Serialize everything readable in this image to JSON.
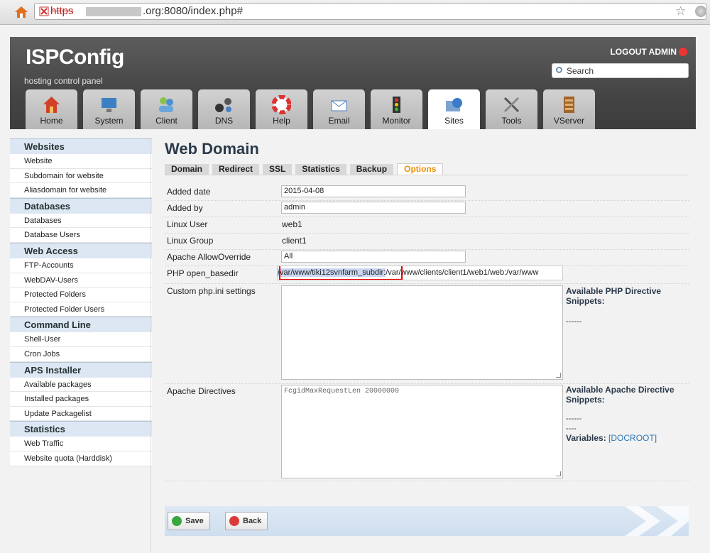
{
  "browser": {
    "url_protocol": "https",
    "url_rest": ".org:8080/index.php#"
  },
  "header": {
    "logo": "ISPConfig",
    "tagline": "hosting control panel",
    "logout": "LOGOUT ADMIN",
    "search_label": "Search"
  },
  "tabs": [
    {
      "label": "Home",
      "icon": "house-icon"
    },
    {
      "label": "System",
      "icon": "monitor-icon"
    },
    {
      "label": "Client",
      "icon": "users-icon"
    },
    {
      "label": "DNS",
      "icon": "network-icon"
    },
    {
      "label": "Help",
      "icon": "lifebuoy-icon"
    },
    {
      "label": "Email",
      "icon": "envelope-icon"
    },
    {
      "label": "Monitor",
      "icon": "traffic-light-icon"
    },
    {
      "label": "Sites",
      "icon": "globe-folder-icon",
      "active": true
    },
    {
      "label": "Tools",
      "icon": "tools-icon"
    },
    {
      "label": "VServer",
      "icon": "server-icon"
    }
  ],
  "sidebar": {
    "sections": [
      {
        "heading": "Websites",
        "items": [
          "Website",
          "Subdomain for website",
          "Aliasdomain for website"
        ]
      },
      {
        "heading": "Databases",
        "items": [
          "Databases",
          "Database Users"
        ]
      },
      {
        "heading": "Web Access",
        "items": [
          "FTP-Accounts",
          "WebDAV-Users",
          "Protected Folders",
          "Protected Folder Users"
        ]
      },
      {
        "heading": "Command Line",
        "items": [
          "Shell-User",
          "Cron Jobs"
        ]
      },
      {
        "heading": "APS Installer",
        "items": [
          "Available packages",
          "Installed packages",
          "Update Packagelist"
        ]
      },
      {
        "heading": "Statistics",
        "items": [
          "Web Traffic",
          "Website quota (Harddisk)"
        ]
      }
    ]
  },
  "main": {
    "title": "Web Domain",
    "subtabs": [
      "Domain",
      "Redirect",
      "SSL",
      "Statistics",
      "Backup",
      "Options"
    ],
    "active_subtab": "Options",
    "fields": {
      "added_date_label": "Added date",
      "added_date_value": "2015-04-08",
      "added_by_label": "Added by",
      "added_by_value": "admin",
      "linux_user_label": "Linux User",
      "linux_user_value": "web1",
      "linux_group_label": "Linux Group",
      "linux_group_value": "client1",
      "allowoverride_label": "Apache AllowOverride",
      "allowoverride_value": "All",
      "basedir_label": "PHP open_basedir",
      "basedir_selected": "/var/www/tiki12svnfarm_subdir:",
      "basedir_rest": "/var/www/clients/client1/web1/web:/var/www",
      "custom_php_label": "Custom php.ini settings",
      "apache_directives_label": "Apache Directives",
      "apache_directives_value": "FcgidMaxRequestLen 20000000"
    },
    "php_snippets_title": "Available PHP Directive Snippets:",
    "php_snippets_text": "------",
    "apache_snippets_title": "Available Apache Directive Snippets:",
    "apache_snippets_text": "------",
    "apache_snippets_text2": "----",
    "variables_label": "Variables:",
    "variables_link": "[DOCROOT]",
    "buttons": {
      "save": "Save",
      "back": "Back"
    }
  }
}
